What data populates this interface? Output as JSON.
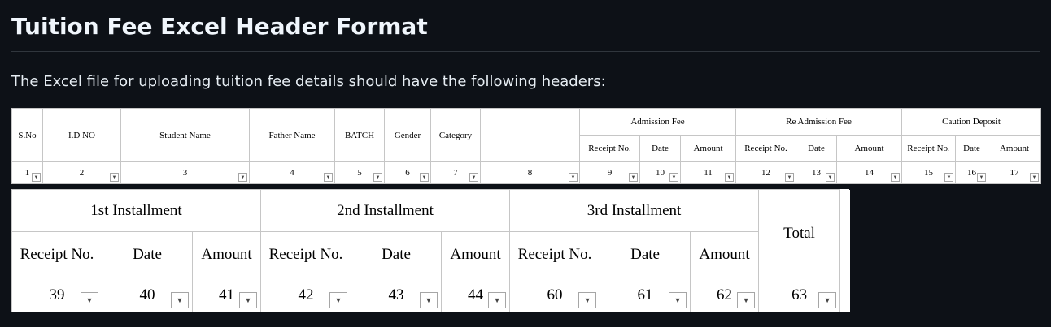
{
  "page": {
    "title": "Tuition Fee Excel Header Format",
    "intro": "The Excel file for uploading tuition fee details should have the following headers:"
  },
  "sheet1": {
    "headers": {
      "sno": "S.No",
      "idno": "I.D NO",
      "student_name": "Student Name",
      "father_name": "Father Name",
      "batch": "BATCH",
      "gender": "Gender",
      "category": "Category",
      "admission_fee": "Admission Fee",
      "readmission_fee": "Re Admission Fee",
      "caution_deposit": "Caution Deposit",
      "receipt_no": "Receipt No.",
      "date": "Date",
      "amount": "Amount"
    },
    "numbers": [
      "1",
      "2",
      "3",
      "4",
      "5",
      "6",
      "7",
      "8",
      "9",
      "10",
      "11",
      "12",
      "13",
      "14",
      "15",
      "16",
      "17"
    ]
  },
  "sheet2": {
    "groups": {
      "first": "1st Installment",
      "second": "2nd Installment",
      "third": "3rd Installment",
      "total": "Total"
    },
    "sub": {
      "receipt_no": "Receipt No.",
      "date": "Date",
      "amount": "Amount"
    },
    "numbers": [
      "39",
      "40",
      "41",
      "42",
      "43",
      "44",
      "60",
      "61",
      "62",
      "63"
    ]
  },
  "icons": {
    "dropdown": "dropdown-arrow-icon"
  },
  "colors": {
    "page_bg": "#0d1117",
    "text": "#e6edf3",
    "sheet_bg": "#ffffff",
    "grid": "#c6c6c6"
  }
}
